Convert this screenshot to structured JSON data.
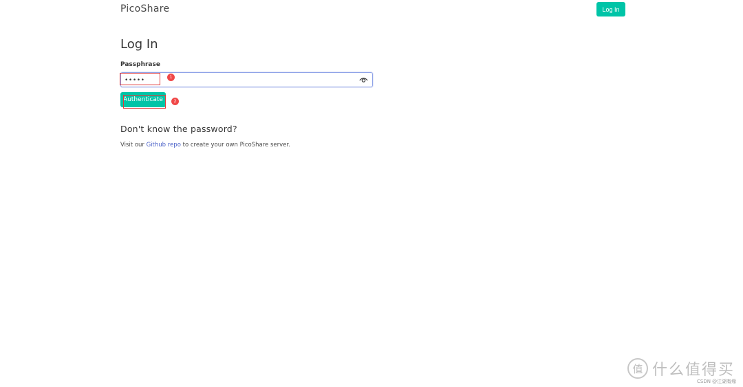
{
  "header": {
    "brand": "PicoShare",
    "login_label": "Log In"
  },
  "main": {
    "title": "Log In",
    "passphrase_label": "Passphrase",
    "passphrase_value": "•••••",
    "authenticate_label": "Authenticate",
    "help_title": "Don't know the password?",
    "help_prefix": "Visit our ",
    "help_link": "Github repo",
    "help_suffix": " to create your own PicoShare server."
  },
  "annotations": {
    "step1": "1",
    "step2": "2"
  },
  "watermark": {
    "logo_char": "值",
    "text": "什么值得买",
    "credit": "CSDN @江湖有缘"
  },
  "colors": {
    "primary": "#00c4a7",
    "link": "#485fc7",
    "annotation": "#e03b3b"
  },
  "icons": {
    "eye": "eye-icon"
  }
}
